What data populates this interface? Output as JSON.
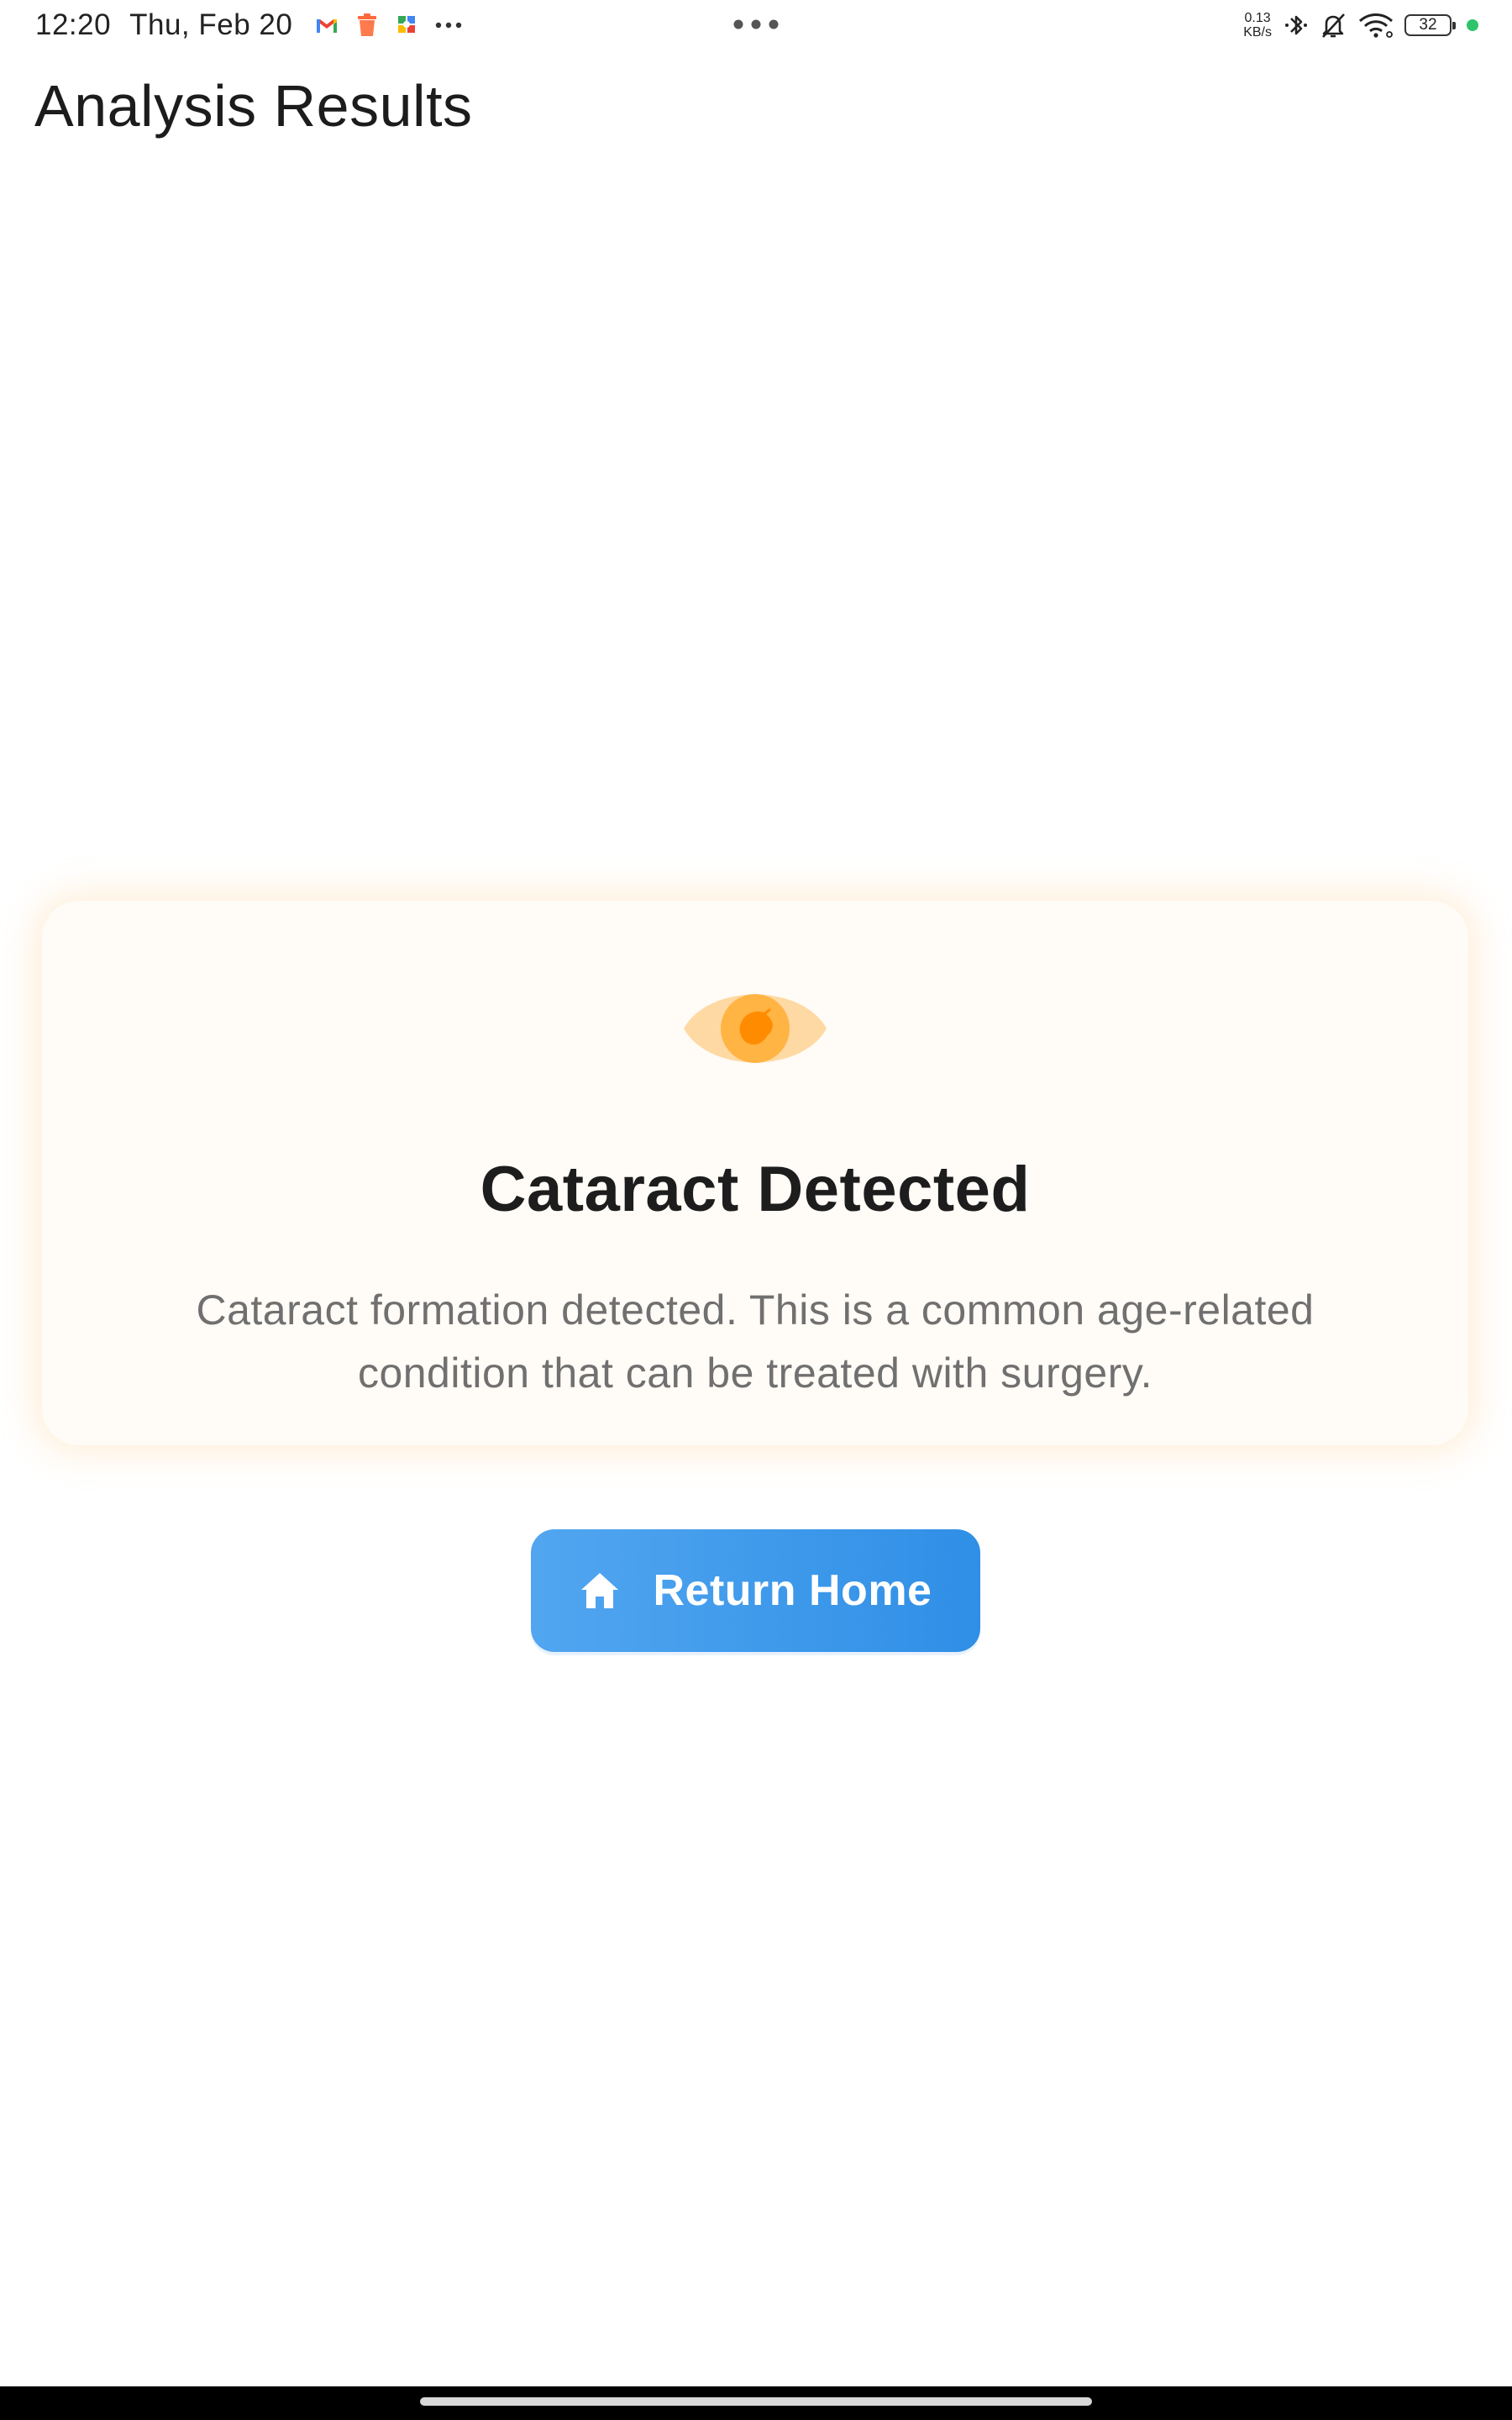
{
  "status_bar": {
    "time": "12:20",
    "date": "Thu, Feb 20",
    "net_speed_value": "0.13",
    "net_speed_unit": "KB/s",
    "battery_level": "32",
    "notification_icons": [
      "gmail-icon",
      "trash-app-icon",
      "puzzle-app-icon",
      "more-notifications-icon"
    ],
    "system_icons": [
      "bluetooth-icon",
      "mute-bell-icon",
      "wifi-icon",
      "battery-icon",
      "charging-dot-icon"
    ],
    "colors": {
      "charging_dot": "#2fc46b"
    }
  },
  "header": {
    "title": "Analysis Results"
  },
  "result": {
    "icon": "eye-icon",
    "title": "Cataract Detected",
    "description": "Cataract formation detected. This is a common age-related condition that can be treated with surgery.",
    "colors": {
      "card_background": "#fffbf6",
      "eye_outer": "#ffd9a3",
      "eye_iris": "#ffb444",
      "eye_pupil": "#ff8c00"
    }
  },
  "actions": {
    "home_button": {
      "label": "Return Home",
      "icon": "home-icon",
      "colors": {
        "start": "#52a6f0",
        "end": "#2f8fe6"
      }
    }
  }
}
